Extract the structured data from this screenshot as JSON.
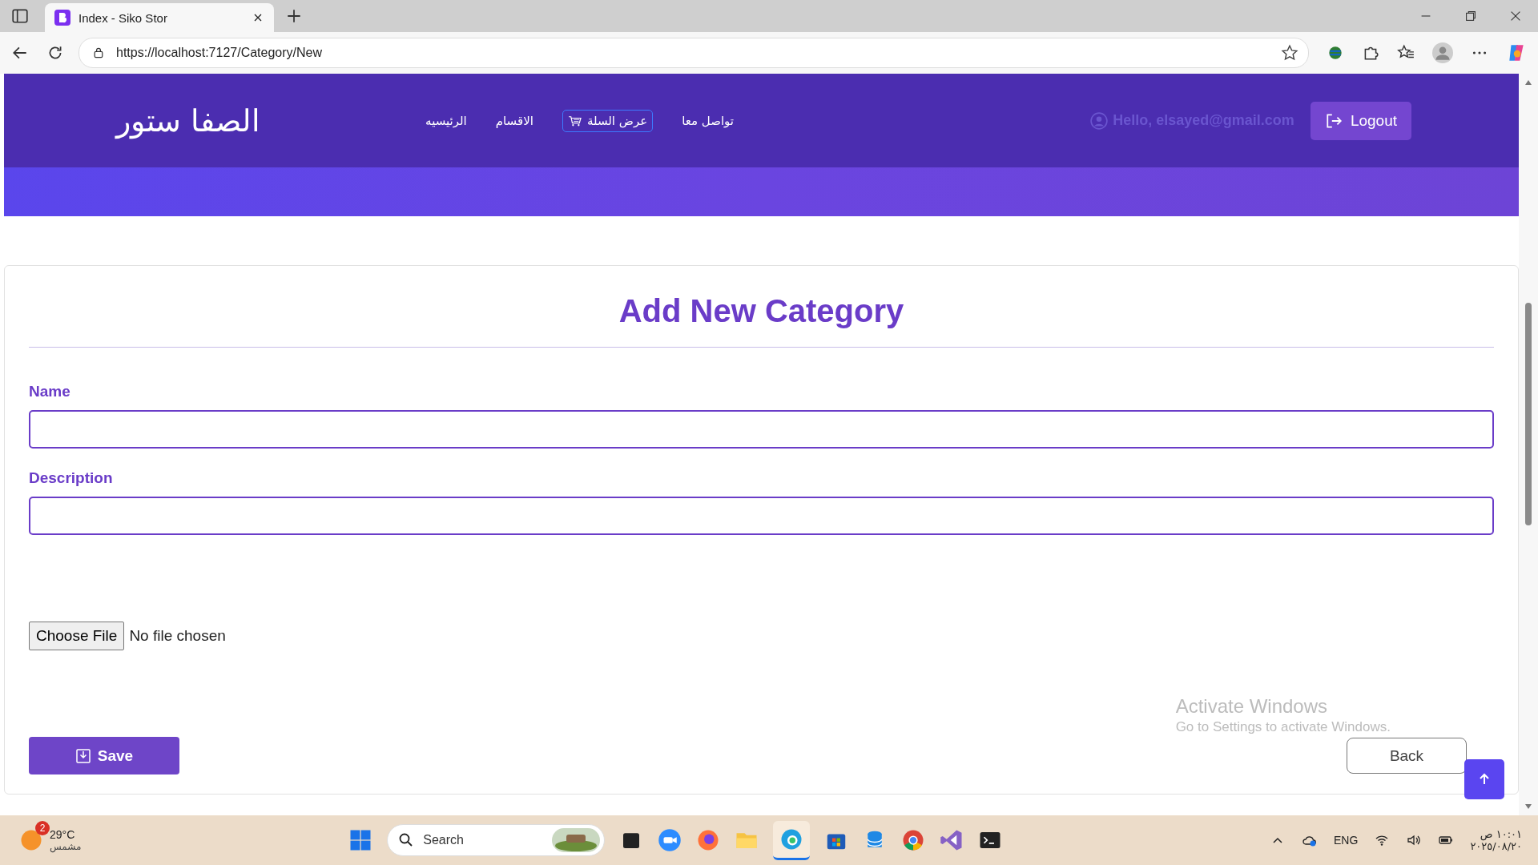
{
  "browser": {
    "tab_title": "Index - Siko Stor",
    "url": "https://localhost:7127/Category/New"
  },
  "header": {
    "logo": "الصفا ستور",
    "nav": [
      {
        "label": "تواصل معا",
        "kind": "link"
      },
      {
        "label": "عرض السلة",
        "kind": "cart"
      },
      {
        "label": "الاقسام",
        "kind": "link"
      },
      {
        "label": "الرئيسيه",
        "kind": "link"
      }
    ],
    "greeting": "Hello, elsayed@gmail.com",
    "logout": "Logout"
  },
  "form": {
    "title": "Add New Category",
    "fields": [
      {
        "label": "Name"
      },
      {
        "label": "Description"
      }
    ],
    "file_button": "Choose File",
    "file_status": "No file chosen",
    "save": "Save",
    "back": "Back"
  },
  "activation": {
    "title": "Activate Windows",
    "text": "Go to Settings to activate Windows."
  },
  "taskbar": {
    "badge": "2",
    "temperature": "29°C",
    "condition": "مشمس",
    "search": {
      "placeholder": "Search"
    },
    "language": "ENG",
    "time": "١٠:٠١ ص",
    "date": "٢٠٢٥/٠٨/٢٠"
  }
}
